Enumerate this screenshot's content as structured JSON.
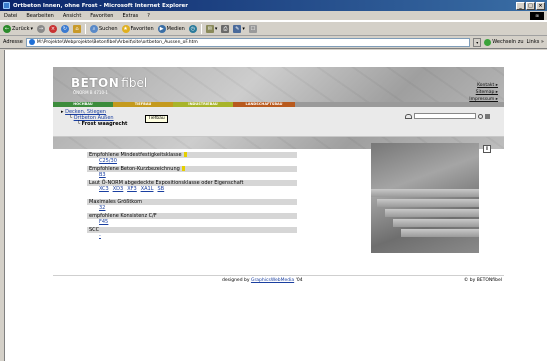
{
  "window": {
    "title": "Ortbeton Innen, ohne Frost - Microsoft Internet Explorer",
    "controls": [
      "_",
      "□",
      "×"
    ]
  },
  "menu": [
    "Datei",
    "Bearbeiten",
    "Ansicht",
    "Favoriten",
    "Extras",
    "?"
  ],
  "toolbar": {
    "back": "Zurück",
    "search": "Suchen",
    "favorites": "Favoriten",
    "media": "Medien"
  },
  "address": {
    "label": "Adresse",
    "url": "M:\\Projekte\\Webprojekte\\Betonfibel\\Arbeit\\site\\ortbeton_Aussen_oF.htm",
    "go": "Wechseln zu",
    "links": "Links »"
  },
  "site": {
    "brand_bold": "BETON",
    "brand_light": "fibel",
    "brand_sub": "ÖNORM B 4710-1",
    "top_links": [
      "Kontakt ▸",
      "Sitemap ▸",
      "Impressum ▸"
    ],
    "nav": [
      {
        "label": "HOCHBAU",
        "color": "#3c8c3c"
      },
      {
        "label": "TIEFBAU",
        "color": "#c49a1e"
      },
      {
        "label": "INDUSTRIEBAU",
        "color": "#a8b42a"
      },
      {
        "label": "LANDSCHAFTSBAU",
        "color": "#b85a1e"
      }
    ],
    "breadcrumb": {
      "l1": "Decken, Stiegen",
      "l2": "Ortbeton Außen",
      "current": "Frost waagrecht"
    },
    "tooltip": "Tiefbau",
    "properties": [
      {
        "label": "Empfohlene Mindestfestigkeitsklasse",
        "info": true,
        "values": [
          "C25/30"
        ]
      },
      {
        "label": "Empfohlene Beton-Kurzbezeichnung",
        "info": true,
        "values": [
          "B3"
        ]
      },
      {
        "label": "Laut Ö-NORM abgedeckte Expositionsklasse oder Eigenschaft",
        "info": false,
        "values": [
          "XC3",
          "XD3",
          "XF3",
          "XA1L",
          "SB"
        ]
      },
      {
        "label": "Maximales Größtkorn",
        "info": false,
        "values": [
          "32"
        ],
        "gap": true
      },
      {
        "label": "empfohlene Konsistenz C/F",
        "info": false,
        "values": [
          "F45"
        ]
      },
      {
        "label": "SCC",
        "info": false,
        "values": [
          "-"
        ]
      }
    ],
    "help": "i",
    "footer": {
      "designed_prefix": "designed by",
      "designer": "GraphicsWebMedia",
      "year": "'04",
      "copyright": "© by BETONfibel"
    }
  }
}
